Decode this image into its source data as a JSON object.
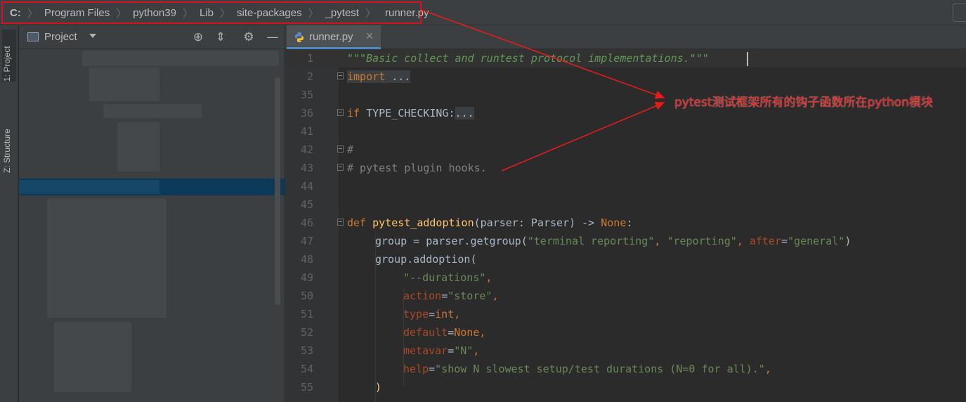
{
  "breadcrumb": {
    "items": [
      "C:",
      "Program Files",
      "python39",
      "Lib",
      "site-packages",
      "_pytest",
      "runner.py"
    ]
  },
  "tool_stripe": {
    "project_tab": "1: Project",
    "structure_tab": "Z: Structure"
  },
  "project_panel": {
    "title": "Project",
    "icons": [
      "locate-icon",
      "collapse-icon",
      "gear-icon",
      "minimize-icon"
    ]
  },
  "editor": {
    "tab_label": "runner.py",
    "lines": [
      {
        "num": "1"
      },
      {
        "num": "2"
      },
      {
        "num": "35"
      },
      {
        "num": "36"
      },
      {
        "num": "41"
      },
      {
        "num": "42"
      },
      {
        "num": "43"
      },
      {
        "num": "44"
      },
      {
        "num": "45"
      },
      {
        "num": "46"
      },
      {
        "num": "47"
      },
      {
        "num": "48"
      },
      {
        "num": "49"
      },
      {
        "num": "50"
      },
      {
        "num": "51"
      },
      {
        "num": "52"
      },
      {
        "num": "53"
      },
      {
        "num": "54"
      },
      {
        "num": "55"
      }
    ],
    "code": {
      "l1": "\"\"\"Basic collect and runtest protocol implementations.\"\"\"",
      "l2_kw": "import",
      "l2_fold": " ...",
      "l36_kw": "if",
      "l36_name": " TYPE_CHECKING:",
      "l36_fold": "...",
      "l42": "#",
      "l43": "# pytest plugin hooks.",
      "l46_kw": "def",
      "l46_fn": "pytest_addoption",
      "l46_open": "(",
      "l46_p": "parser",
      "l46_sig": ": Parser) -> ",
      "l46_none": "None",
      "l46_colon": ":",
      "l47_a": "group = parser.getgroup(",
      "l47_s1": "\"terminal reporting\"",
      "l47_c1": ", ",
      "l47_s2": "\"reporting\"",
      "l47_c2": ", ",
      "l47_p": "after",
      "l47_eq": "=",
      "l47_s3": "\"general\"",
      "l47_close": ")",
      "l48": "group.addoption(",
      "l49_s": "\"--durations\"",
      "l49_c": ",",
      "l50_p": "action",
      "l50_eq": "=",
      "l50_s": "\"store\"",
      "l50_c": ",",
      "l51_p": "type",
      "l51_eq": "=",
      "l51_v": "int",
      "l51_c": ",",
      "l52_p": "default",
      "l52_eq": "=",
      "l52_v": "None",
      "l52_c": ",",
      "l53_p": "metavar",
      "l53_eq": "=",
      "l53_s": "\"N\"",
      "l53_c": ",",
      "l54_p": "help",
      "l54_eq": "=",
      "l54_s": "\"show N slowest setup/test durations (N=0 for all).\"",
      "l54_c": ",",
      "l55": ")"
    }
  },
  "annotation": {
    "text": "pytest测试框架所有的钩子函数所在python模块",
    "color": "#e81b1b"
  }
}
